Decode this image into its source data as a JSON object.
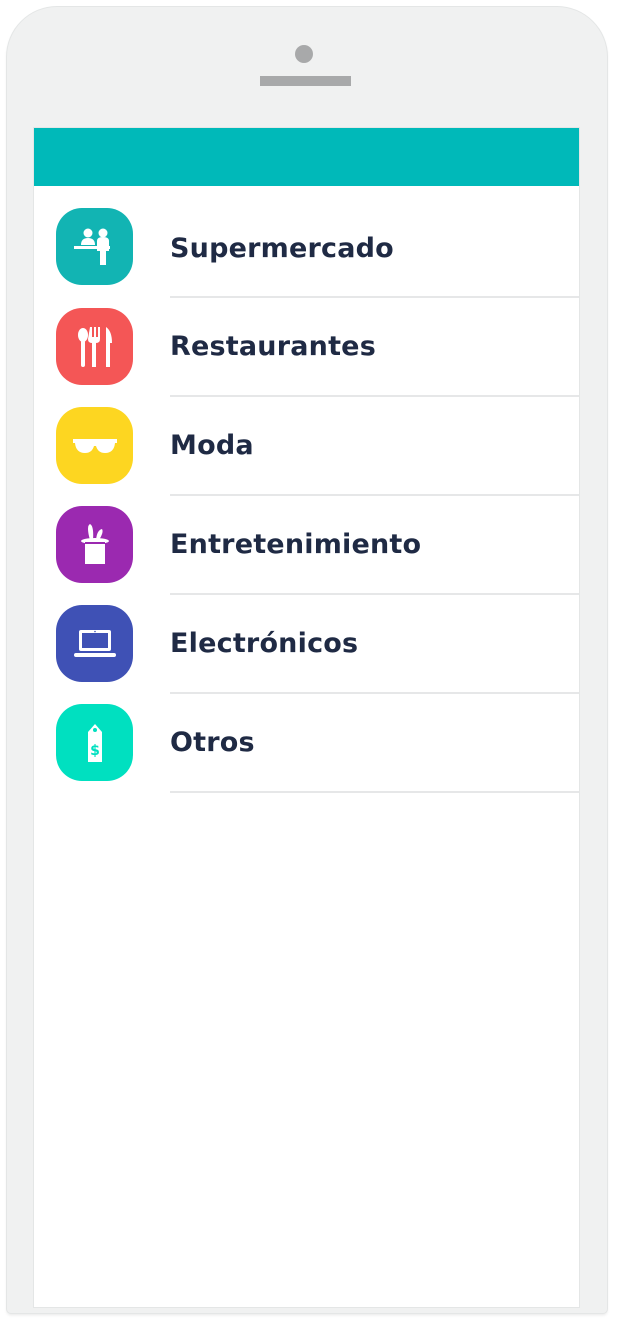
{
  "header": {
    "color": "#00b9b9"
  },
  "categories": [
    {
      "label": "Supermercado",
      "icon": "cashier-icon",
      "color": "#12b4b3"
    },
    {
      "label": "Restaurantes",
      "icon": "cutlery-icon",
      "color": "#f45656"
    },
    {
      "label": "Moda",
      "icon": "sunglasses-icon",
      "color": "#fdd621"
    },
    {
      "label": "Entretenimiento",
      "icon": "magic-hat-rabbit-icon",
      "color": "#9b29b0"
    },
    {
      "label": "Electrónicos",
      "icon": "laptop-icon",
      "color": "#3f51b5"
    },
    {
      "label": "Otros",
      "icon": "price-tag-icon",
      "color": "#00e0c0"
    }
  ]
}
